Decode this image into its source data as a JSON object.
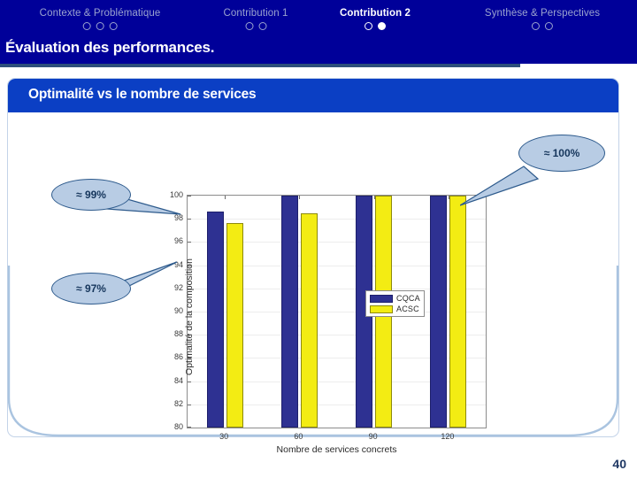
{
  "header": {
    "subtitle": "Évaluation des performances.",
    "sections": [
      {
        "label": "Contexte & Problématique",
        "dots": [
          false,
          false,
          false
        ],
        "active": false
      },
      {
        "label": "Contribution 1",
        "dots": [
          false,
          false
        ],
        "active": false
      },
      {
        "label": "Contribution 2",
        "dots": [
          false,
          true
        ],
        "active": true
      },
      {
        "label": "Synthèse & Perspectives",
        "dots": [
          false,
          false
        ],
        "active": false
      }
    ]
  },
  "card": {
    "title": "Optimalité vs le nombre de services"
  },
  "callouts": [
    {
      "label": "≈ 100%"
    },
    {
      "label": "≈ 99%"
    },
    {
      "label": "≈ 97%"
    }
  ],
  "footer": {
    "page_number": "40"
  },
  "colors": {
    "header_navy": "#000099",
    "card_title_blue": "#0b3fc4",
    "series_cqca": "#2e3192",
    "series_acsc": "#f3ec13",
    "callout_fill": "#b8cce4",
    "callout_stroke": "#2d5a8c",
    "card_border": "#c3d3e8"
  },
  "chart_data": {
    "type": "bar",
    "title": "",
    "xlabel": "Nombre de services concrets",
    "ylabel": "Optimalité de la composition",
    "categories": [
      "30",
      "60",
      "90",
      "120"
    ],
    "ylim": [
      80,
      100
    ],
    "yticks": [
      80,
      82,
      84,
      86,
      88,
      90,
      92,
      94,
      96,
      98,
      100
    ],
    "grid": true,
    "legend_position": "center-right",
    "series": [
      {
        "name": "CQCA",
        "color": "#2e3192",
        "values": [
          98.6,
          100,
          100,
          100
        ]
      },
      {
        "name": "ACSC",
        "color": "#f3ec13",
        "values": [
          97.6,
          98.5,
          100,
          100
        ]
      }
    ]
  }
}
